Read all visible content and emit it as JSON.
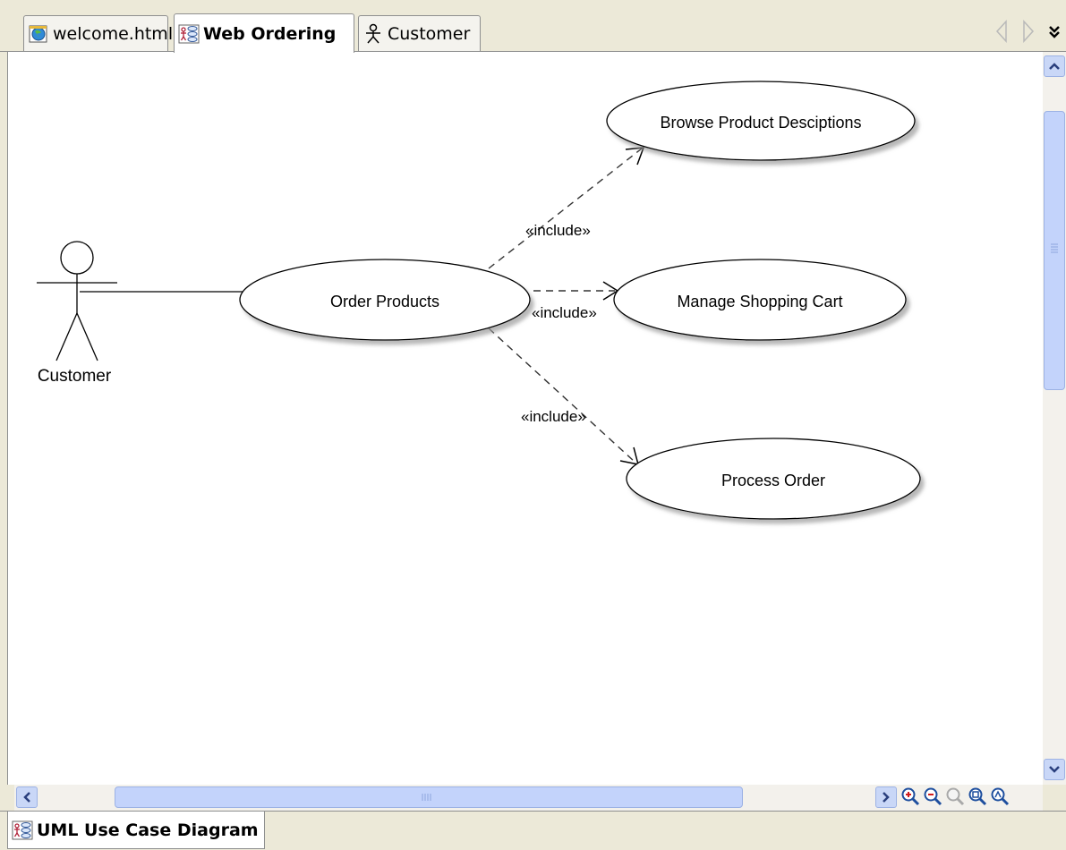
{
  "tabs": [
    {
      "label": "welcome.html",
      "icon": "web-page-icon",
      "active": false
    },
    {
      "label": "Web Ordering",
      "icon": "uml-diagram-icon",
      "active": true
    },
    {
      "label": "Customer",
      "icon": "actor-icon",
      "active": false
    }
  ],
  "diagram": {
    "actor": "Customer",
    "use_cases": {
      "order": "Order Products",
      "browse": "Browse Product Desciptions",
      "cart": "Manage Shopping Cart",
      "process": "Process Order"
    },
    "include_label": "«include»"
  },
  "zoom_tools": [
    "zoom-in-icon",
    "zoom-out-icon",
    "zoom-actual-icon",
    "zoom-fit-icon",
    "zoom-selection-icon"
  ],
  "bottom_tab": {
    "label": "UML Use Case Diagram",
    "icon": "uml-diagram-icon"
  },
  "colors": {
    "selection": "#c3d3fb",
    "canvas": "#ffffff",
    "frame": "#ece9d8"
  }
}
